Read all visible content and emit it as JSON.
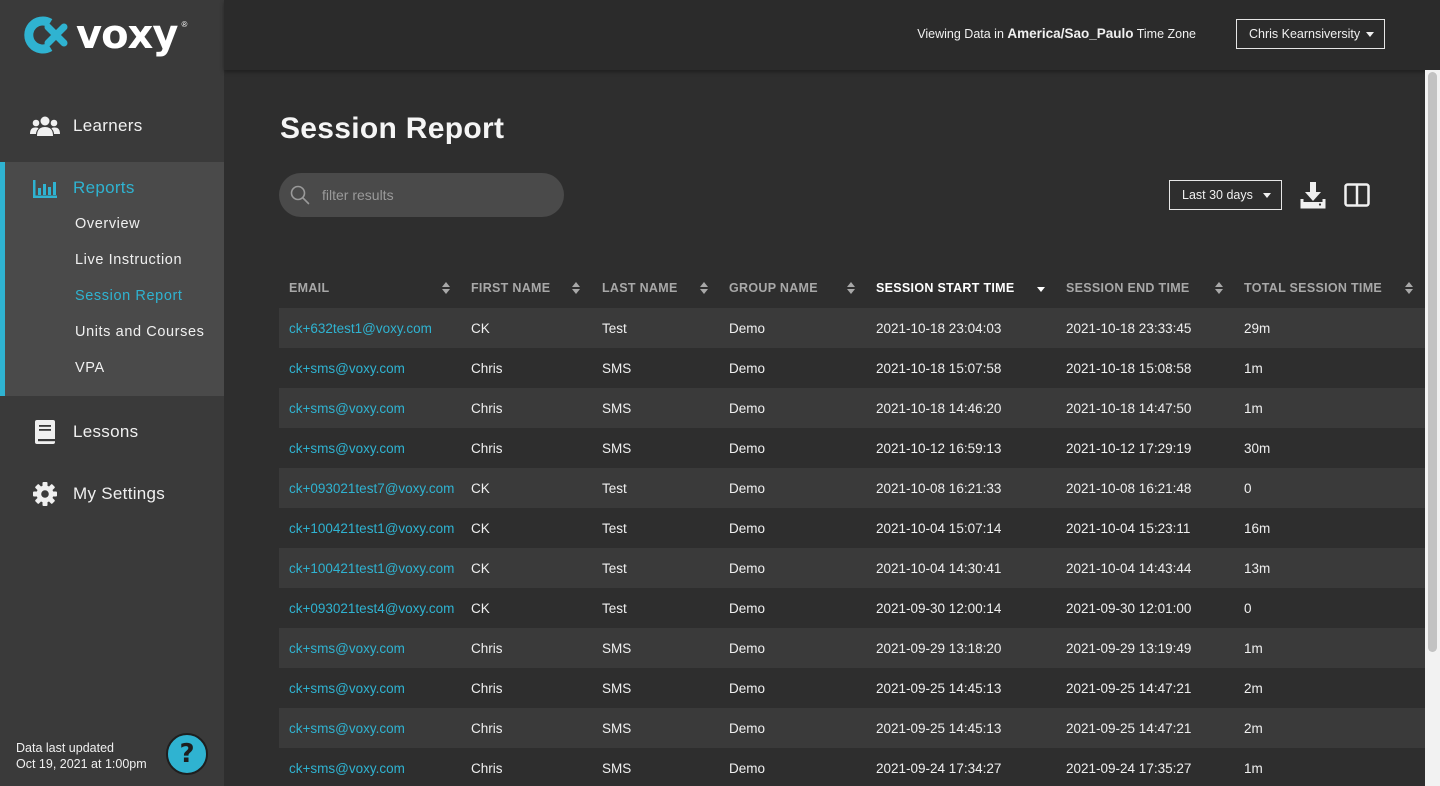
{
  "brand": {
    "name": "voxy",
    "reg": "®",
    "color": "#2fb3d1"
  },
  "sidebar": {
    "items": [
      {
        "label": "Learners",
        "icon": "users-icon"
      },
      {
        "label": "Reports",
        "icon": "bar-chart-icon"
      },
      {
        "label": "Lessons",
        "icon": "book-icon"
      },
      {
        "label": "My Settings",
        "icon": "gear-icon"
      }
    ],
    "reports_sub": [
      {
        "label": "Overview"
      },
      {
        "label": "Live Instruction"
      },
      {
        "label": "Session Report"
      },
      {
        "label": "Units and Courses"
      },
      {
        "label": "VPA"
      }
    ],
    "updated_line1": "Data last updated",
    "updated_line2": "Oct 19, 2021 at 1:00pm",
    "help": "?"
  },
  "topbar": {
    "tz_prefix": "Viewing Data in",
    "tz_value": "America/Sao_Paulo",
    "tz_suffix": "Time Zone",
    "user": "Chris Kearnsiversity"
  },
  "main": {
    "title": "Session Report",
    "search_placeholder": "filter results",
    "range": "Last 30 days"
  },
  "table": {
    "columns": [
      "EMAIL",
      "FIRST NAME",
      "LAST NAME",
      "GROUP NAME",
      "SESSION START TIME",
      "SESSION END TIME",
      "TOTAL SESSION TIME"
    ],
    "rows": [
      [
        "ck+632test1@voxy.com",
        "CK",
        "Test",
        "Demo",
        "2021-10-18 23:04:03",
        "2021-10-18 23:33:45",
        "29m"
      ],
      [
        "ck+sms@voxy.com",
        "Chris",
        "SMS",
        "Demo",
        "2021-10-18 15:07:58",
        "2021-10-18 15:08:58",
        "1m"
      ],
      [
        "ck+sms@voxy.com",
        "Chris",
        "SMS",
        "Demo",
        "2021-10-18 14:46:20",
        "2021-10-18 14:47:50",
        "1m"
      ],
      [
        "ck+sms@voxy.com",
        "Chris",
        "SMS",
        "Demo",
        "2021-10-12 16:59:13",
        "2021-10-12 17:29:19",
        "30m"
      ],
      [
        "ck+093021test7@voxy.com",
        "CK",
        "Test",
        "Demo",
        "2021-10-08 16:21:33",
        "2021-10-08 16:21:48",
        "0"
      ],
      [
        "ck+100421test1@voxy.com",
        "CK",
        "Test",
        "Demo",
        "2021-10-04 15:07:14",
        "2021-10-04 15:23:11",
        "16m"
      ],
      [
        "ck+100421test1@voxy.com",
        "CK",
        "Test",
        "Demo",
        "2021-10-04 14:30:41",
        "2021-10-04 14:43:44",
        "13m"
      ],
      [
        "ck+093021test4@voxy.com",
        "CK",
        "Test",
        "Demo",
        "2021-09-30 12:00:14",
        "2021-09-30 12:01:00",
        "0"
      ],
      [
        "ck+sms@voxy.com",
        "Chris",
        "SMS",
        "Demo",
        "2021-09-29 13:18:20",
        "2021-09-29 13:19:49",
        "1m"
      ],
      [
        "ck+sms@voxy.com",
        "Chris",
        "SMS",
        "Demo",
        "2021-09-25 14:45:13",
        "2021-09-25 14:47:21",
        "2m"
      ],
      [
        "ck+sms@voxy.com",
        "Chris",
        "SMS",
        "Demo",
        "2021-09-25 14:45:13",
        "2021-09-25 14:47:21",
        "2m"
      ],
      [
        "ck+sms@voxy.com",
        "Chris",
        "SMS",
        "Demo",
        "2021-09-24 17:34:27",
        "2021-09-24 17:35:27",
        "1m"
      ]
    ]
  }
}
